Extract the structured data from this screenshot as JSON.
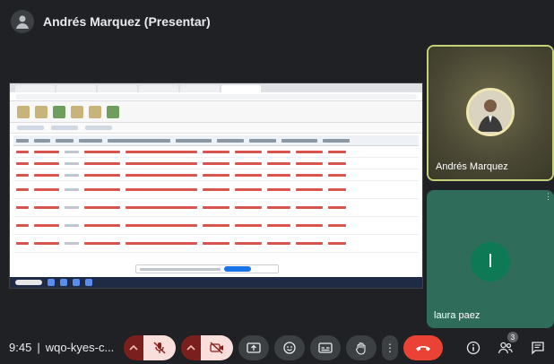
{
  "presenter": {
    "label": "Andrés Marquez (Presentar)"
  },
  "participants": [
    {
      "name": "Andrés Marquez"
    },
    {
      "name": "laura paez",
      "initial": "l"
    }
  ],
  "meeting": {
    "time": "9:45",
    "separator": "|",
    "code": "wqo-kyes-c..."
  },
  "people_count": "3",
  "colors": {
    "background": "#202124",
    "end_call": "#ea4335",
    "mic_off": "#f9dedc",
    "laura_tile": "#2f6c59",
    "andres_border": "#c5d07a"
  },
  "icons": [
    "presenter-avatar-icon",
    "mic-off-icon",
    "camera-off-icon",
    "present-icon",
    "emoji-icon",
    "captions-icon",
    "raise-hand-icon",
    "more-options-icon",
    "end-call-icon",
    "info-icon",
    "people-icon",
    "chat-icon"
  ]
}
